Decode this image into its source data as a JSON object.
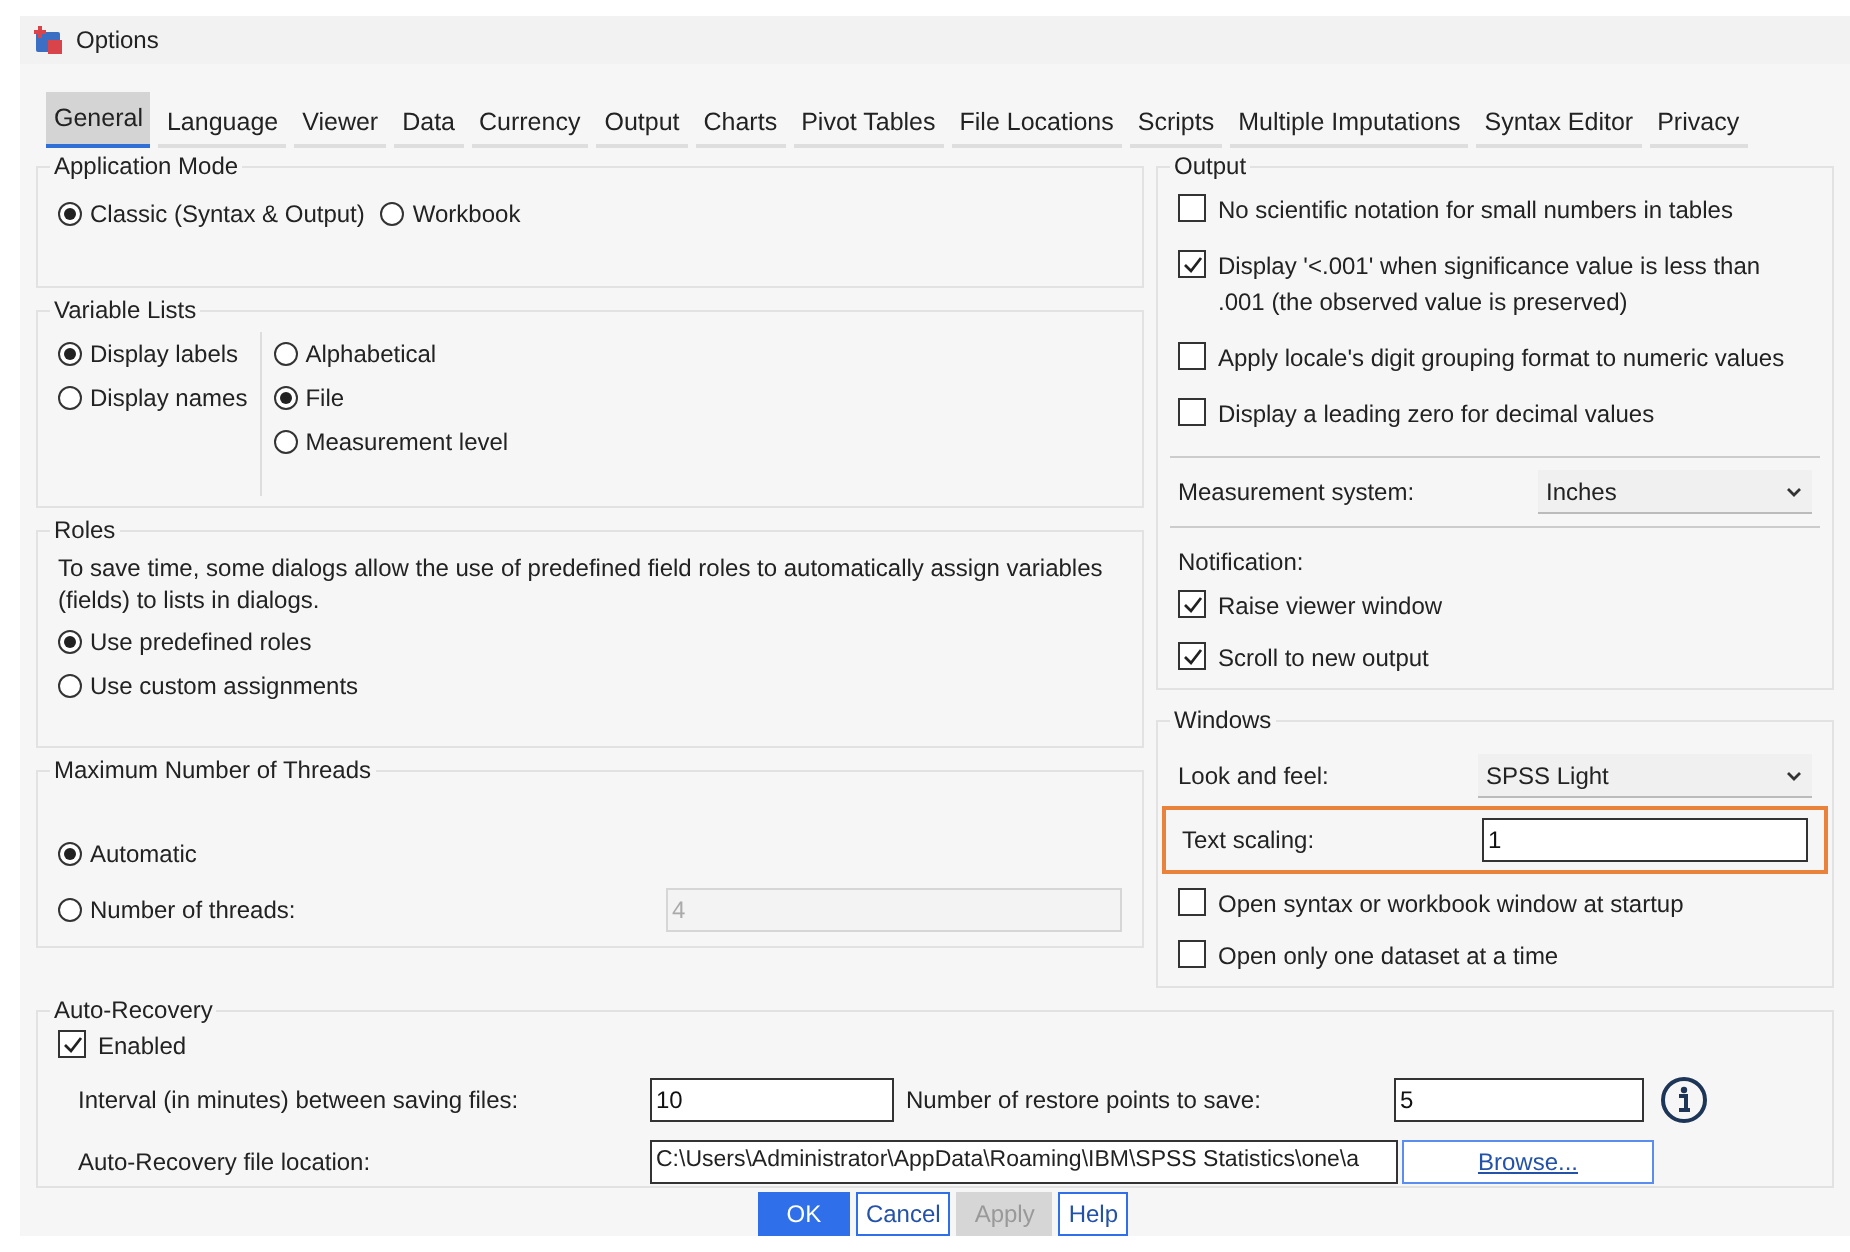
{
  "window": {
    "title": "Options"
  },
  "tabs": [
    {
      "label": "General",
      "selected": true
    },
    {
      "label": "Language",
      "selected": false
    },
    {
      "label": "Viewer",
      "selected": false
    },
    {
      "label": "Data",
      "selected": false
    },
    {
      "label": "Currency",
      "selected": false
    },
    {
      "label": "Output",
      "selected": false
    },
    {
      "label": "Charts",
      "selected": false
    },
    {
      "label": "Pivot Tables",
      "selected": false
    },
    {
      "label": "File Locations",
      "selected": false
    },
    {
      "label": "Scripts",
      "selected": false
    },
    {
      "label": "Multiple Imputations",
      "selected": false
    },
    {
      "label": "Syntax Editor",
      "selected": false
    },
    {
      "label": "Privacy",
      "selected": false
    }
  ],
  "application_mode": {
    "title": "Application Mode",
    "options": [
      {
        "label": "Classic (Syntax & Output)",
        "selected": true
      },
      {
        "label": "Workbook",
        "selected": false
      }
    ]
  },
  "variable_lists": {
    "title": "Variable Lists",
    "display": [
      {
        "label": "Display labels",
        "selected": true
      },
      {
        "label": "Display names",
        "selected": false
      }
    ],
    "order": [
      {
        "label": "Alphabetical",
        "selected": false
      },
      {
        "label": "File",
        "selected": true
      },
      {
        "label": "Measurement level",
        "selected": false
      }
    ]
  },
  "roles": {
    "title": "Roles",
    "description": "To save time, some dialogs allow the use of predefined field roles to automatically assign variables (fields) to lists in dialogs.",
    "options": [
      {
        "label": "Use predefined roles",
        "selected": true
      },
      {
        "label": "Use custom assignments",
        "selected": false
      }
    ]
  },
  "threads": {
    "title": "Maximum Number of Threads",
    "options": [
      {
        "label": "Automatic",
        "selected": true
      },
      {
        "label": "Number of threads:",
        "selected": false
      }
    ],
    "field": {
      "value": "4",
      "disabled": true
    }
  },
  "output": {
    "title": "Output",
    "options": [
      {
        "label": "No scientific notation for small numbers in tables",
        "checked": false
      },
      {
        "label": "Display '<.001' when significance value is less than .001 (the observed value is preserved)",
        "checked": true
      },
      {
        "label": "Apply locale's digit grouping format to numeric values",
        "checked": false
      },
      {
        "label": "Display a leading zero for decimal values",
        "checked": false
      }
    ],
    "measurement": {
      "label": "Measurement system:",
      "value": "Inches"
    },
    "notification": {
      "title": "Notification:",
      "options": [
        {
          "label": "Raise viewer window",
          "checked": true
        },
        {
          "label": "Scroll to new output",
          "checked": true
        }
      ]
    }
  },
  "windows": {
    "title": "Windows",
    "look_and_feel": {
      "label": "Look and feel:",
      "value": "SPSS Light"
    },
    "text_scaling": {
      "label": "Text scaling:",
      "value": "1",
      "highlighted": true
    },
    "options": [
      {
        "label": "Open syntax or workbook window at startup",
        "checked": false
      },
      {
        "label": "Open only one dataset at a time",
        "checked": false
      }
    ]
  },
  "auto_recovery": {
    "title": "Auto-Recovery",
    "enabled": {
      "label": "Enabled",
      "checked": true
    },
    "interval": {
      "label": "Interval (in minutes) between saving files:",
      "value": "10"
    },
    "restore_points": {
      "label": "Number of restore points to save:",
      "value": "5"
    },
    "location": {
      "label": "Auto-Recovery file location:",
      "value": "C:\\Users\\Administrator\\AppData\\Roaming\\IBM\\SPSS Statistics\\one\\a"
    },
    "browse": "Browse..."
  },
  "buttons": [
    {
      "label": "OK",
      "kind": "primary"
    },
    {
      "label": "Cancel",
      "kind": "normal"
    },
    {
      "label": "Apply",
      "kind": "disabled"
    },
    {
      "label": "Help",
      "kind": "normal"
    }
  ]
}
